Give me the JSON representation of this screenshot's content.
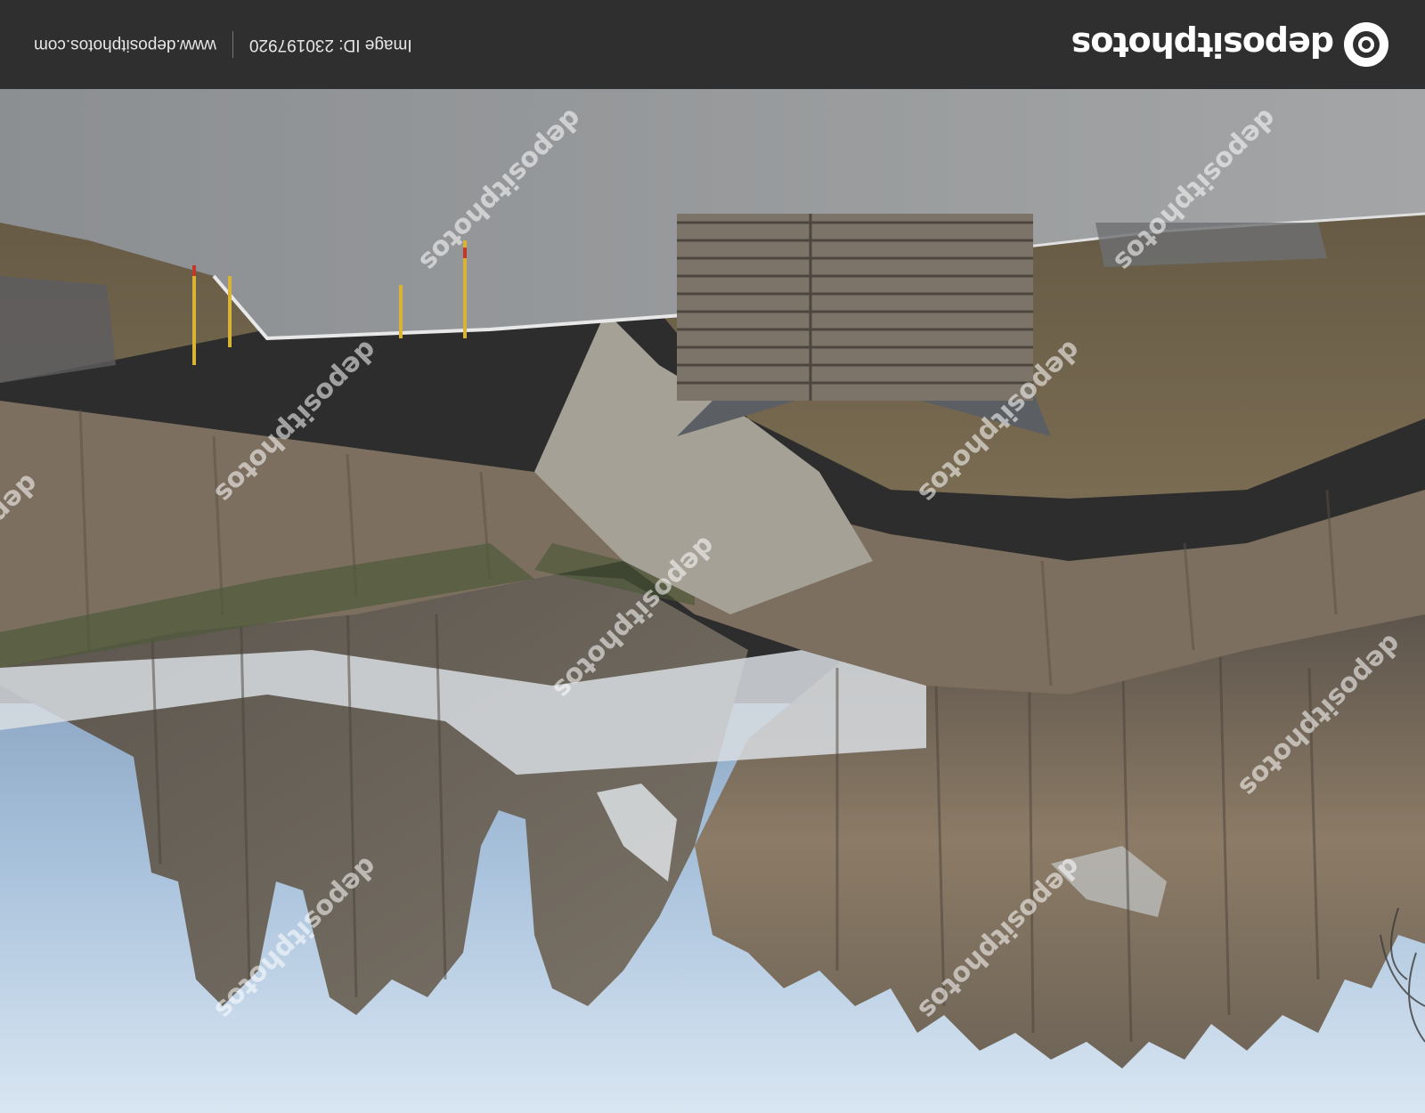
{
  "brand": {
    "name": "depositphotos",
    "icon": "camera-lens-icon"
  },
  "meta": {
    "image_id": "Image ID: 230197920",
    "website": "www.depositphotos.com"
  },
  "watermark": {
    "text": "depositphotos"
  },
  "colors": {
    "bar": "#2f2f2f",
    "sky": "#b9d0e6",
    "rock": "#8a7e6e",
    "road": "#9a9c9e"
  }
}
